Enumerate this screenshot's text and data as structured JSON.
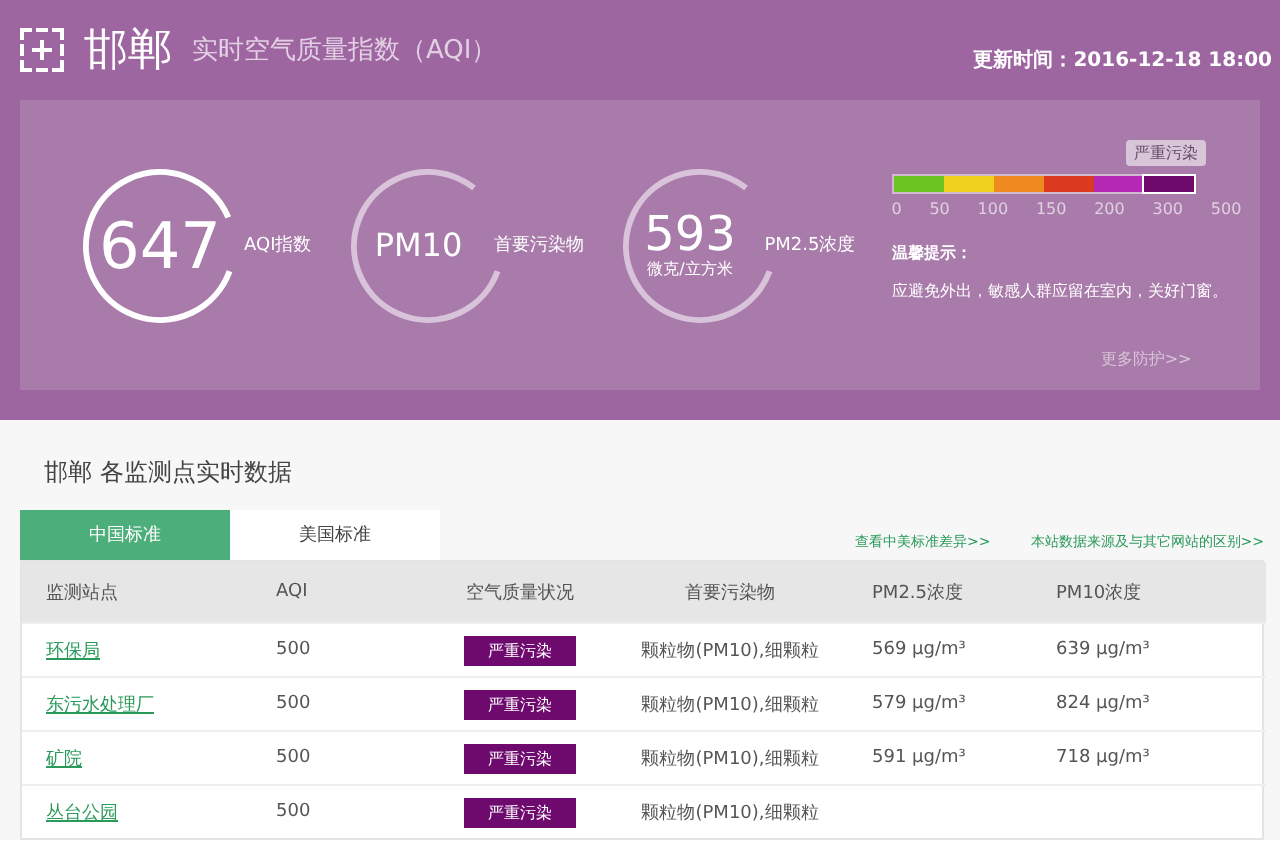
{
  "header": {
    "city": "邯郸",
    "subtitle": "实时空气质量指数（AQI）",
    "updated": "更新时间：2016-12-18 18:00"
  },
  "summary": [
    {
      "kind": "full",
      "value": "647",
      "unit": "AQI指数"
    },
    {
      "kind": "partial",
      "value": "PM10",
      "unit": "首要污染物"
    },
    {
      "kind": "partial",
      "value": "593",
      "sub": "微克/立方米",
      "unit": "PM2.5浓度"
    }
  ],
  "scale": {
    "segments": [
      {
        "color": "#6cc423",
        "selected": false
      },
      {
        "color": "#f0d21e",
        "selected": false
      },
      {
        "color": "#f08a1e",
        "selected": false
      },
      {
        "color": "#dc3a1e",
        "selected": false
      },
      {
        "color": "#b428b4",
        "selected": false
      },
      {
        "color": "#6e0a6e",
        "selected": true
      }
    ],
    "current": "严重污染",
    "ticks": [
      "0",
      "50",
      "100",
      "150",
      "200",
      "300",
      "500"
    ]
  },
  "tip": {
    "title": "温馨提示：",
    "text": "应避免外出，敏感人群应留在室内，关好门窗。",
    "more": "更多防护>>"
  },
  "stations": {
    "title": "邯郸 各监测点实时数据",
    "tabs": [
      {
        "label": "中国标准",
        "selected": true
      },
      {
        "label": "美国标准",
        "selected": false
      }
    ],
    "links": [
      "查看中美标准差异>>",
      "本站数据来源及与其它网站的区别>>"
    ],
    "columns": [
      "监测站点",
      "AQI",
      "空气质量状况",
      "首要污染物",
      "PM2.5浓度",
      "PM10浓度"
    ],
    "rows": [
      {
        "station": "环保局",
        "aqi": "500",
        "status": "严重污染",
        "pollutant": "颗粒物(PM10),细颗粒",
        "pm25": "569 μg/m³",
        "pm10": "639 μg/m³"
      },
      {
        "station": "东污水处理厂",
        "aqi": "500",
        "status": "严重污染",
        "pollutant": "颗粒物(PM10),细颗粒",
        "pm25": "579 μg/m³",
        "pm10": "824 μg/m³"
      },
      {
        "station": "矿院",
        "aqi": "500",
        "status": "严重污染",
        "pollutant": "颗粒物(PM10),细颗粒",
        "pm25": "591 μg/m³",
        "pm10": "718 μg/m³"
      },
      {
        "station": "丛台公园",
        "aqi": "500",
        "status": "严重污染",
        "pollutant": "颗粒物(PM10),细颗粒"
      }
    ]
  }
}
